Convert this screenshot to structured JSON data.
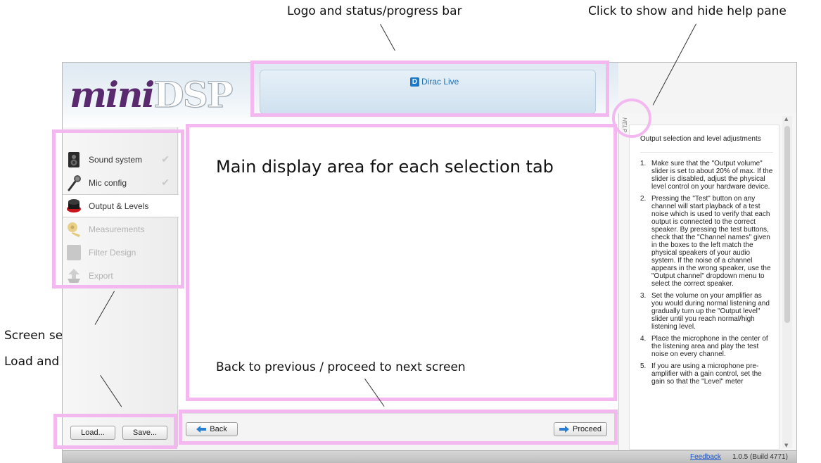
{
  "annotations": {
    "logo_status": "Logo and status/progress bar",
    "help_toggle": "Click to show and hide help pane",
    "main_area": "Main display area for each selection tab",
    "tabs": "Screen selection tabs",
    "load_save": "Load and save a project",
    "nav": "Back to previous / proceed to next screen"
  },
  "header": {
    "logo_mini": "mini",
    "logo_dsp": "DSP",
    "dirac_label": "Dirac Live"
  },
  "sidebar": {
    "tabs": [
      {
        "label": "Sound system",
        "state": "done"
      },
      {
        "label": "Mic config",
        "state": "done"
      },
      {
        "label": "Output & Levels",
        "state": "active"
      },
      {
        "label": "Measurements",
        "state": "disabled"
      },
      {
        "label": "Filter Design",
        "state": "disabled"
      },
      {
        "label": "Export",
        "state": "disabled"
      }
    ],
    "load_label": "Load...",
    "save_label": "Save..."
  },
  "nav": {
    "back_label": "Back",
    "proceed_label": "Proceed"
  },
  "help": {
    "tab_label": "HELP",
    "title": "Output selection and level adjustments",
    "steps": [
      {
        "num": "1.",
        "text": "Make sure that the \"Output volume\" slider is set to about 20% of max. If the slider is disabled, adjust the physical level control on your hardware device."
      },
      {
        "num": "2.",
        "text": "Pressing the \"Test\" button on any channel will start playback of a test noise which is used to verify that each output is connected to the correct speaker. By pressing the test buttons, check that the \"Channel names\" given in the boxes to the left match the physical speakers of your audio system. If the noise of a channel appears in the wrong speaker, use the \"Output channel\" dropdown menu to select the correct speaker."
      },
      {
        "num": "3.",
        "text": "Set the volume on your amplifier as you would during normal listening and gradually turn up the \"Output level\" slider until you reach normal/high listening level."
      },
      {
        "num": "4.",
        "text": "Place the microphone in the center of the listening area and play the test noise on every channel."
      },
      {
        "num": "5.",
        "text": "If you are using a microphone pre-amplifier with a gain control, set the gain so that the \"Level\" meter"
      }
    ]
  },
  "footer": {
    "feedback": "Feedback",
    "version": "1.0.5 (Build 4771)"
  }
}
